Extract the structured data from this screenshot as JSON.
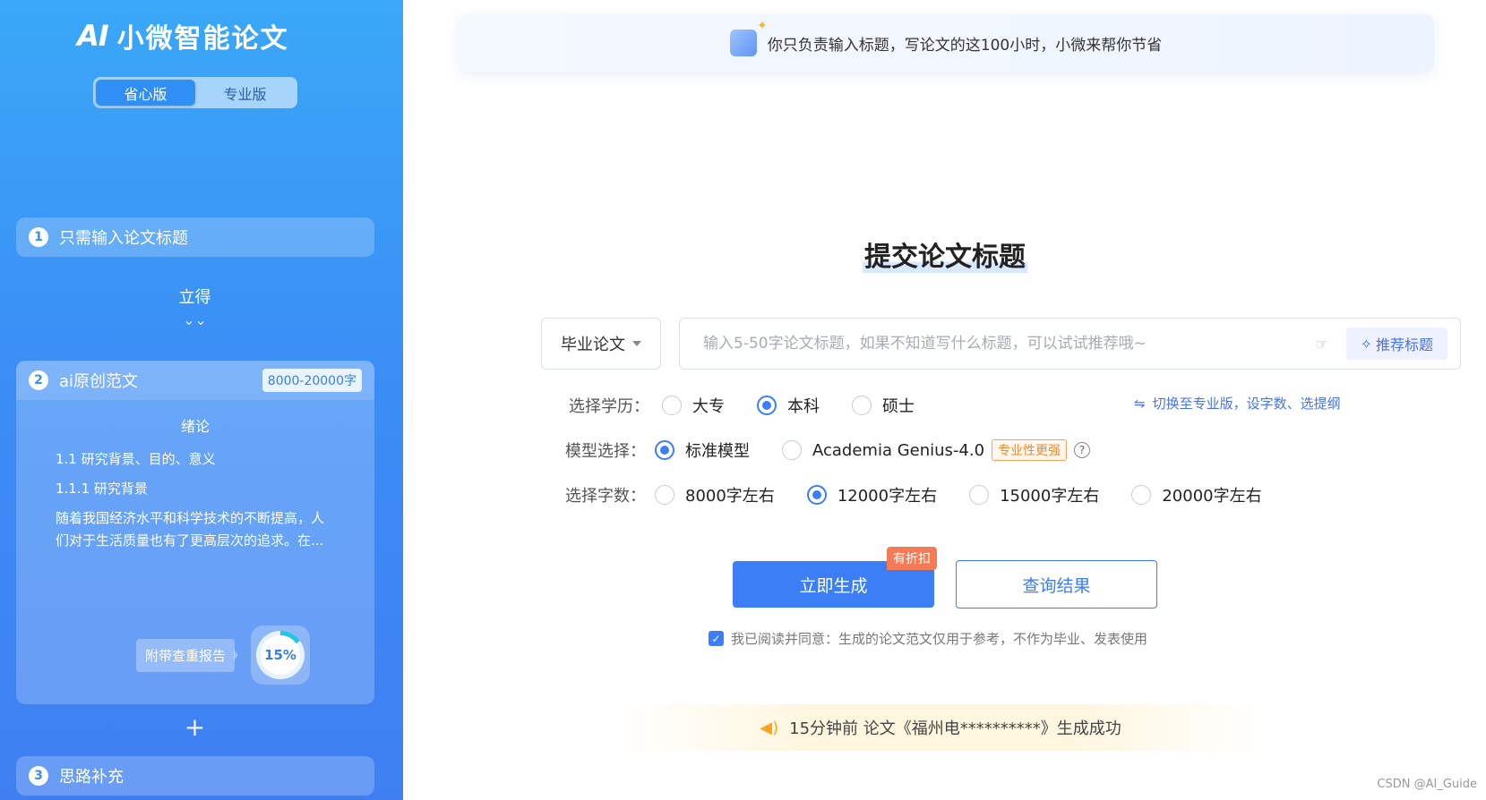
{
  "sidebar": {
    "logo_mark": "AI",
    "logo_text": "小微智能论文",
    "modes": [
      "省心版",
      "专业版"
    ],
    "step1": {
      "num": "1",
      "label": "只需输入论文标题"
    },
    "connector": "立得",
    "step2": {
      "num": "2",
      "label": "ai原创范文",
      "tag": "8000-20000字",
      "essay_heading": "绪论",
      "line1": "1.1 研究背景、目的、意义",
      "line2": "1.1.1 研究背景",
      "paragraph": "随着我国经济水平和科学技术的不断提高，人们对于生活质量也有了更高层次的追求。在...",
      "report_tag": "附带查重报告",
      "report_percent": "15%"
    },
    "step3": {
      "num": "3",
      "label": "思路补充"
    }
  },
  "banner": {
    "text": "你只负责输入标题，写论文的这100小时，小微来帮你节省"
  },
  "form": {
    "title": "提交论文标题",
    "type_value": "毕业论文",
    "input_placeholder": "输入5-50字论文标题，如果不知道写什么标题，可以试试推荐哦~",
    "recommend_label": "推荐标题",
    "education": {
      "label": "选择学历：",
      "options": [
        "大专",
        "本科",
        "硕士"
      ],
      "selected": "本科"
    },
    "switch_link": "切换至专业版，设字数、选提纲",
    "model": {
      "label": "模型选择：",
      "options": [
        "标准模型",
        "Academia Genius-4.0"
      ],
      "selected": "标准模型",
      "badge": "专业性更强"
    },
    "words": {
      "label": "选择字数：",
      "options": [
        "8000字左右",
        "12000字左右",
        "15000字左右",
        "20000字左右"
      ],
      "selected": "12000字左右"
    },
    "generate_label": "立即生成",
    "discount_label": "有折扣",
    "query_label": "查询结果",
    "agree_text": "我已阅读并同意：生成的论文范文仅用于参考，不作为毕业、发表使用"
  },
  "notice": {
    "text": "15分钟前 论文《福州电**********》生成成功"
  },
  "credit": "CSDN @AI_Guide",
  "colors": {
    "primary": "#3b7ef5",
    "sidebar": "#3b8ef6",
    "discount": "#f47b56"
  }
}
